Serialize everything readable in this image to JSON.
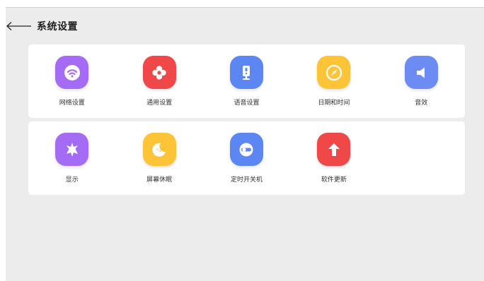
{
  "header": {
    "title": "系统设置"
  },
  "rows": [
    [
      {
        "label": "网络设置",
        "icon": "wifi-icon",
        "color": "#a46cf4"
      },
      {
        "label": "通用设置",
        "icon": "flower-icon",
        "color": "#f04848"
      },
      {
        "label": "语音设置",
        "icon": "speaker-device-icon",
        "color": "#5c86f2"
      },
      {
        "label": "日期和时间",
        "icon": "compass-icon",
        "color": "#fdc437"
      },
      {
        "label": "音效",
        "icon": "volume-icon",
        "color": "#6c8cf4"
      }
    ],
    [
      {
        "label": "显示",
        "icon": "sun-icon",
        "color": "#a46cf4"
      },
      {
        "label": "屏幕休眠",
        "icon": "moon-icon",
        "color": "#fdc437"
      },
      {
        "label": "定时开关机",
        "icon": "power-toggle-icon",
        "color": "#5c86f2"
      },
      {
        "label": "软件更新",
        "icon": "upgrade-arrow-icon",
        "color": "#f04848"
      }
    ]
  ]
}
